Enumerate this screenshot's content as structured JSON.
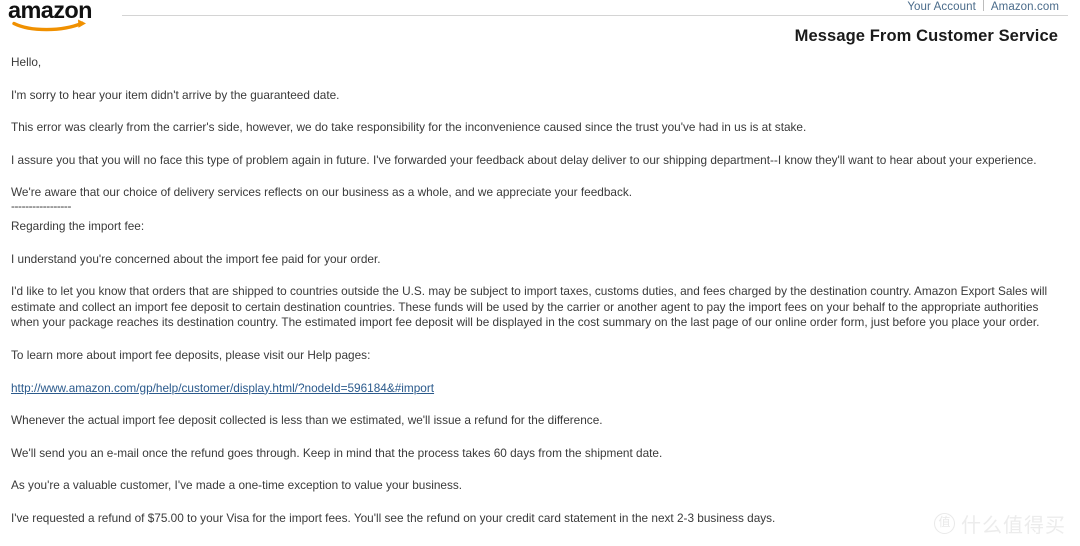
{
  "header": {
    "logo_alt": "amazon",
    "links": [
      {
        "label": "Your Account"
      },
      {
        "label": "Amazon.com"
      }
    ],
    "title": "Message From Customer Service"
  },
  "message": {
    "greeting": "Hello,",
    "paragraphs": [
      "I'm sorry to hear your item didn't arrive by the guaranteed date.",
      "This error was clearly from the carrier's side, however, we do take responsibility for the inconvenience caused since the trust you've had in us is at stake.",
      "I assure you that you will no face this type of problem again in future. I've forwarded your feedback about delay deliver to our shipping department--I know they'll want to hear about your experience.",
      "We're aware that our choice of delivery services reflects on our business as a whole, and we appreciate your feedback."
    ],
    "divider": "-----------------",
    "section_heading": "Regarding the import fee:",
    "import_paragraphs": [
      "I understand you're concerned about the import fee paid for your order.",
      "I'd like to let you know that orders that are shipped to countries outside the U.S. may be subject to import taxes, customs duties, and fees charged by the destination country. Amazon Export Sales will estimate and collect an import fee deposit to certain destination countries. These funds will be used by the carrier or another agent to pay the import fees on your behalf to the appropriate authorities when your package reaches its destination country. The estimated import fee deposit will be displayed in the cost summary on the last page of our online order form, just before you place your order.",
      "To learn more about import fee deposits, please visit our Help pages:"
    ],
    "help_link_text": "http://www.amazon.com/gp/help/customer/display.html/?nodeId=596184&#import",
    "closing_paragraphs": [
      "Whenever the actual import fee deposit collected is less than we estimated, we'll issue a refund for the difference.",
      "We'll send you an e-mail once the refund goes through. Keep in mind that the process takes 60 days from the shipment date.",
      "As you're a valuable customer, I've made a one-time exception to value your business.",
      "I've requested a refund of $75.00 to your Visa  for the import fees. You'll see the refund on your credit card statement in the next 2-3 business days."
    ]
  },
  "watermark": {
    "badge": "值",
    "text": "什么值得买"
  },
  "colors": {
    "link": "#2b5a8c",
    "header_link": "#4a6b8a",
    "brand_orange": "#f09000",
    "text": "#3a3a3a"
  }
}
